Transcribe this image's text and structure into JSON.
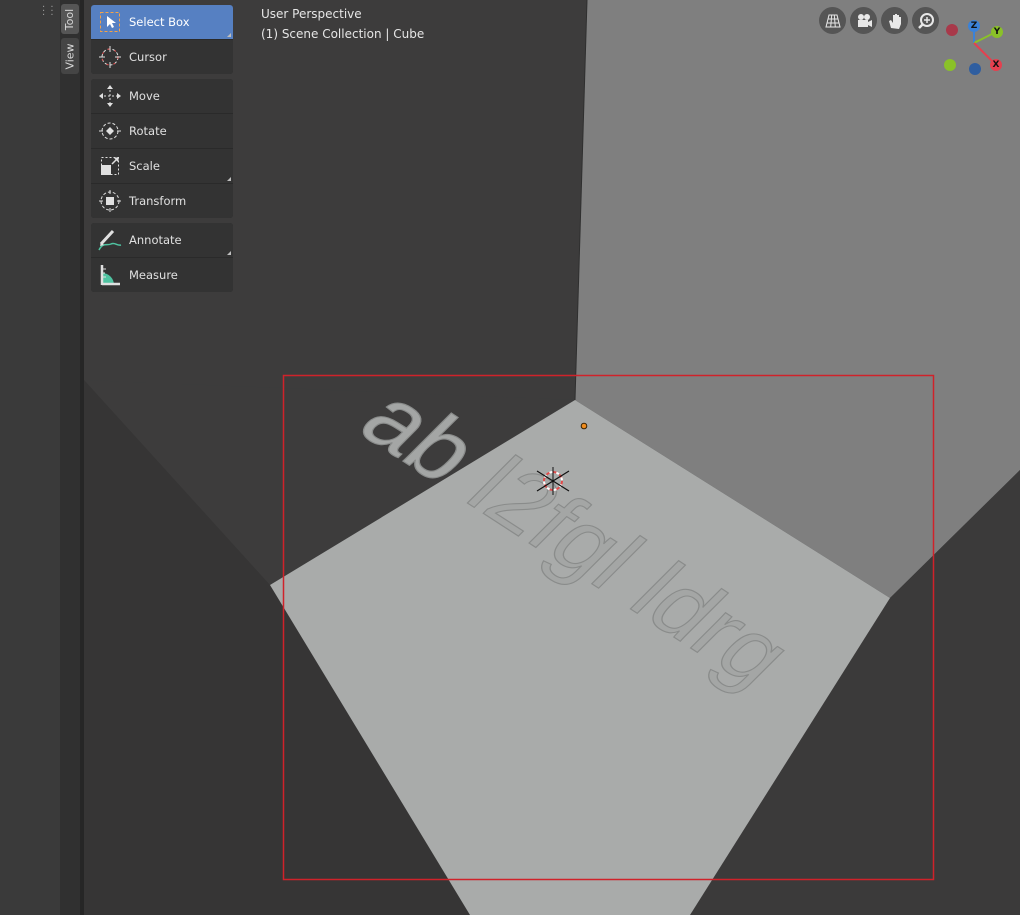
{
  "side_tabs": {
    "tool": "Tool",
    "view": "View"
  },
  "toolbar": {
    "groups": [
      [
        {
          "label": "Select Box",
          "icon": "select-box-icon",
          "active": true
        },
        {
          "label": "Cursor",
          "icon": "cursor-icon"
        }
      ],
      [
        {
          "label": "Move",
          "icon": "move-icon"
        },
        {
          "label": "Rotate",
          "icon": "rotate-icon"
        },
        {
          "label": "Scale",
          "icon": "scale-icon"
        },
        {
          "label": "Transform",
          "icon": "transform-icon"
        }
      ],
      [
        {
          "label": "Annotate",
          "icon": "annotate-icon"
        },
        {
          "label": "Measure",
          "icon": "measure-icon"
        }
      ]
    ]
  },
  "viewport": {
    "perspective": "User Perspective",
    "collection": "(1) Scene Collection | Cube",
    "scene_text": "ab l2fgl ldrg",
    "colors": {
      "wall_dark": "#3d3c3c",
      "wall_light": "#7f7f7f",
      "floor": "#a9abaa",
      "render_border": "#d0222a",
      "active_tool": "#5680c2"
    }
  },
  "nav_icons": [
    "grid-toggle-icon",
    "camera-view-icon",
    "pan-hand-icon",
    "zoom-icon"
  ],
  "gizmo": {
    "x": "X",
    "y": "Y",
    "z": "Z",
    "x_color": "#e5404f",
    "y_color": "#8ac128",
    "z_color": "#3b82d8"
  }
}
